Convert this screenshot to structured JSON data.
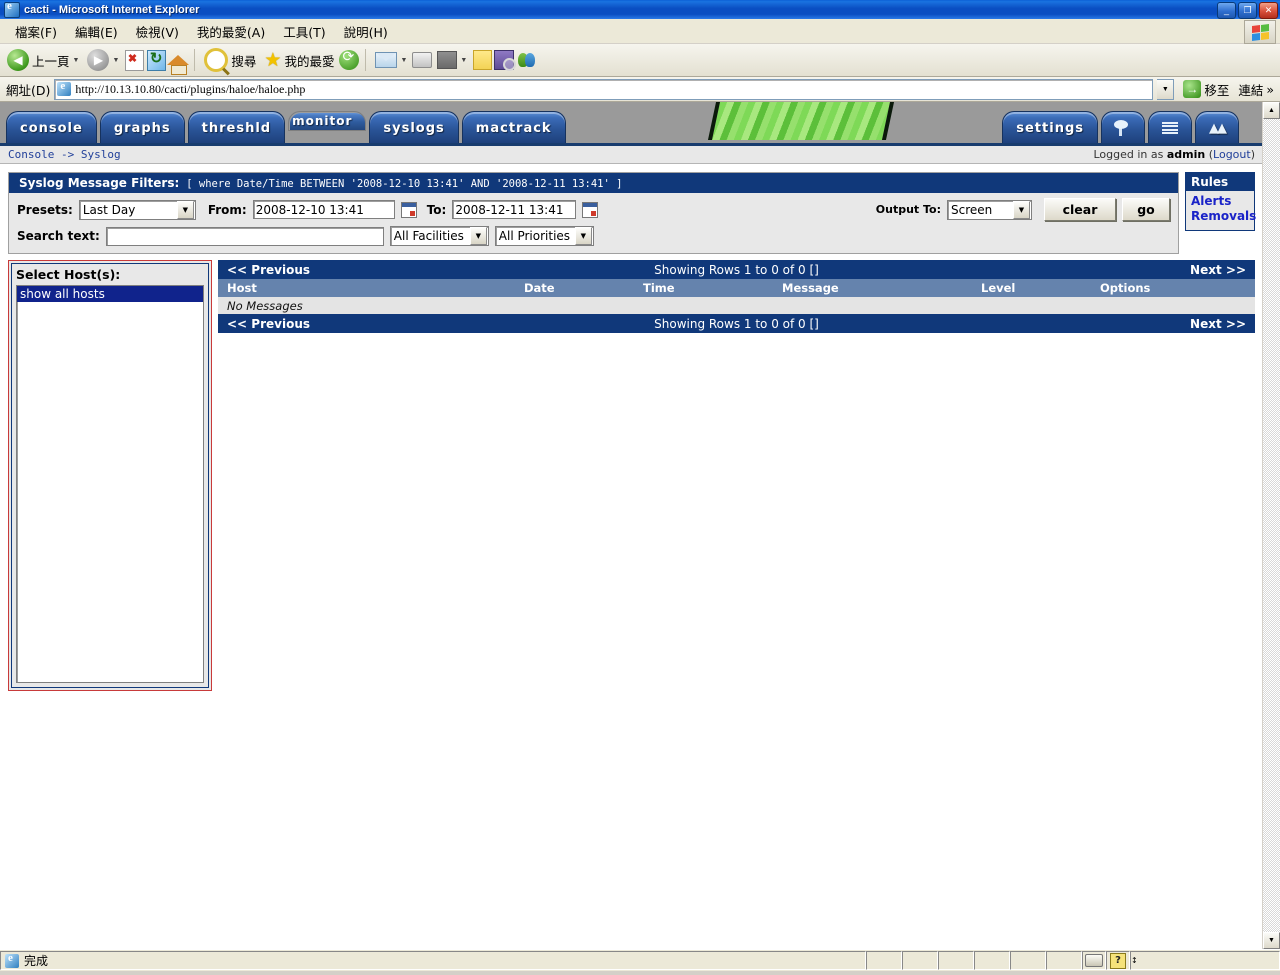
{
  "window": {
    "title": "cacti - Microsoft Internet Explorer",
    "icon": "ie-document-icon",
    "minimize": "_",
    "maximize": "❐",
    "close": "✕"
  },
  "menubar": {
    "items": [
      {
        "label": "檔案(F)",
        "name": "menu-file"
      },
      {
        "label": "編輯(E)",
        "name": "menu-edit"
      },
      {
        "label": "檢視(V)",
        "name": "menu-view"
      },
      {
        "label": "我的最愛(A)",
        "name": "menu-favorites"
      },
      {
        "label": "工具(T)",
        "name": "menu-tools"
      },
      {
        "label": "說明(H)",
        "name": "menu-help"
      }
    ]
  },
  "toolbar": {
    "back_label": "上一頁",
    "back_arrow": "◀",
    "forward_arrow": "▶",
    "dropdown_caret": "▼",
    "search_label": "搜尋",
    "favorites_label": "我的最愛",
    "star_glyph": "★"
  },
  "address": {
    "label": "網址(D)",
    "url": "http://10.13.10.80/cacti/plugins/haloe/haloe.php",
    "go_label": "移至",
    "go_arrow": "→",
    "links_label": "連結",
    "links_chevron": "»",
    "dropdown_caret": "▼"
  },
  "cacti": {
    "tabs": [
      {
        "label": "console",
        "name": "tab-console",
        "selected": false
      },
      {
        "label": "graphs",
        "name": "tab-graphs",
        "selected": false
      },
      {
        "label": "threshld",
        "name": "tab-threshld",
        "selected": false
      },
      {
        "label": "monitor",
        "name": "tab-monitor",
        "selected": true
      },
      {
        "label": "syslogs",
        "name": "tab-syslogs",
        "selected": false
      },
      {
        "label": "mactrack",
        "name": "tab-mactrack",
        "selected": false
      }
    ],
    "right_tabs": [
      {
        "label": "settings",
        "name": "tab-settings"
      }
    ],
    "icon_tabs": [
      {
        "name": "tab-tree-icon"
      },
      {
        "name": "tab-list-icon"
      },
      {
        "name": "tab-graph-icon"
      }
    ],
    "breadcrumb": "Console -> Syslog",
    "login_prefix": "Logged in as",
    "login_user": "admin",
    "logout_open": " (",
    "logout_label": "Logout",
    "logout_close": ")"
  },
  "filters": {
    "title": "Syslog Message Filters:",
    "condition": "[ where Date/Time BETWEEN '2008-12-10 13:41' AND '2008-12-11 13:41' ]",
    "presets_label": "Presets:",
    "presets_value": "Last Day",
    "from_label": "From:",
    "from_value": "2008-12-10 13:41",
    "to_label": "To:",
    "to_value": "2008-12-11 13:41",
    "search_label": "Search text:",
    "search_value": "",
    "facilities_value": "All Facilities",
    "priorities_value": "All Priorities",
    "output_label": "Output To:",
    "output_value": "Screen",
    "clear_label": "clear",
    "go_label": "go"
  },
  "rules": {
    "title": "Rules",
    "links": [
      {
        "label": "Alerts",
        "name": "rules-link-alerts"
      },
      {
        "label": "Removals",
        "name": "rules-link-removals"
      }
    ]
  },
  "hosts": {
    "title": "Select Host(s):",
    "options": [
      {
        "label": "show all hosts",
        "selected": true
      }
    ]
  },
  "results": {
    "prev_label": "<< Previous",
    "next_label": "Next >>",
    "showing_label": "Showing Rows 1 to 0 of 0 []",
    "columns": [
      {
        "label": "Host",
        "name": "col-host"
      },
      {
        "label": "Date",
        "name": "col-date"
      },
      {
        "label": "Time",
        "name": "col-time"
      },
      {
        "label": "Message",
        "name": "col-message"
      },
      {
        "label": "Level",
        "name": "col-level"
      },
      {
        "label": "Options",
        "name": "col-options"
      }
    ],
    "empty_text": "No Messages",
    "rows": []
  },
  "statusbar": {
    "status_text": "完成",
    "question_glyph": "?",
    "updown_glyph": "↕"
  },
  "colors": {
    "cacti_blue": "#10387a",
    "col_header": "#6583ad",
    "host_border_red": "#c83a3a",
    "link_blue": "#1a23c8",
    "title_blue": "#0a4ec2"
  }
}
